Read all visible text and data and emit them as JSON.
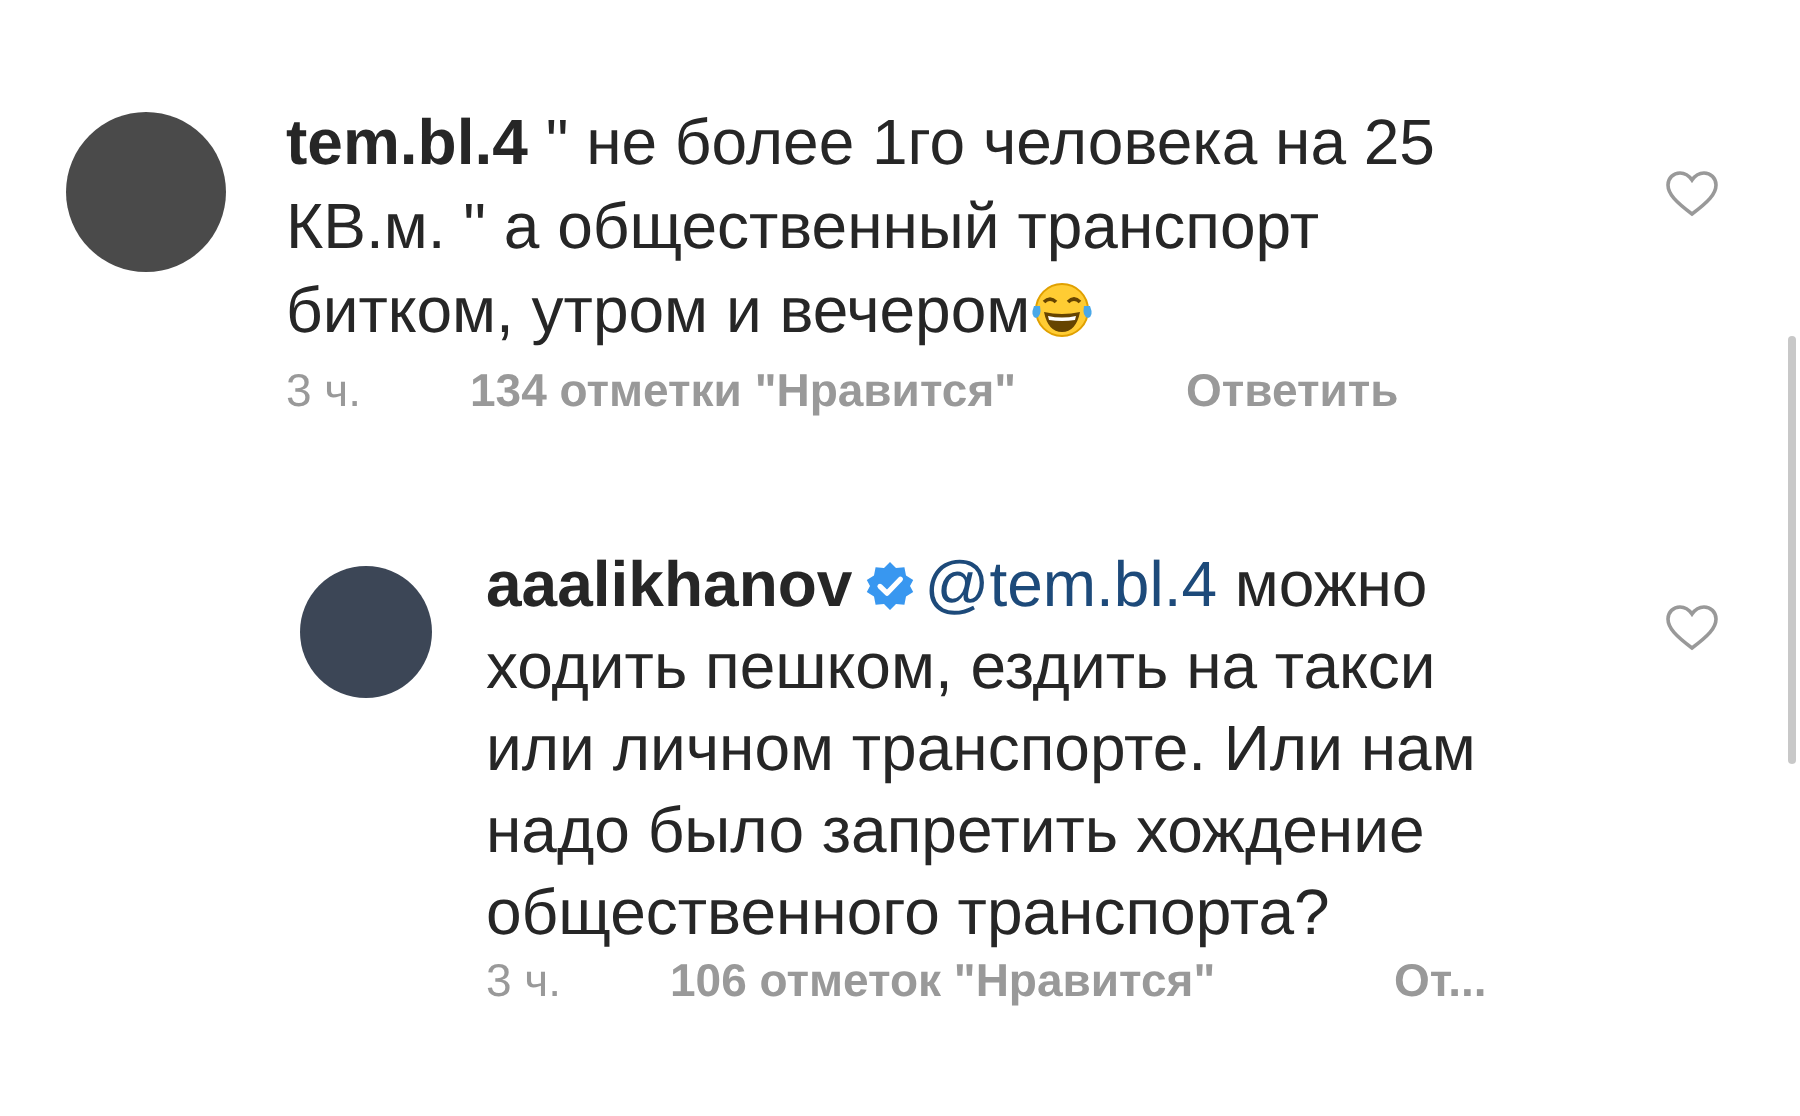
{
  "comments": [
    {
      "username": "tem.bl.4",
      "verified": false,
      "text": "\" не более 1го человека на 25 КВ.м. \" а общественный транспорт битком, утром и вечером",
      "emoji": true,
      "time": "3 ч.",
      "likes": "134 отметки \"Нравится\"",
      "reply": "Ответить",
      "liked": false,
      "is_reply": false
    },
    {
      "username": "aaalikhanov",
      "verified": true,
      "mention": "@tem.bl.4",
      "text": "можно ходить пешком, ездить на такси или личном транспорте. Или нам надо было запретить хождение общественного транспорта?",
      "emoji": false,
      "time": "3 ч.",
      "likes": "106 отметок \"Нравится\"",
      "reply": "От...",
      "liked": false,
      "is_reply": true
    }
  ]
}
